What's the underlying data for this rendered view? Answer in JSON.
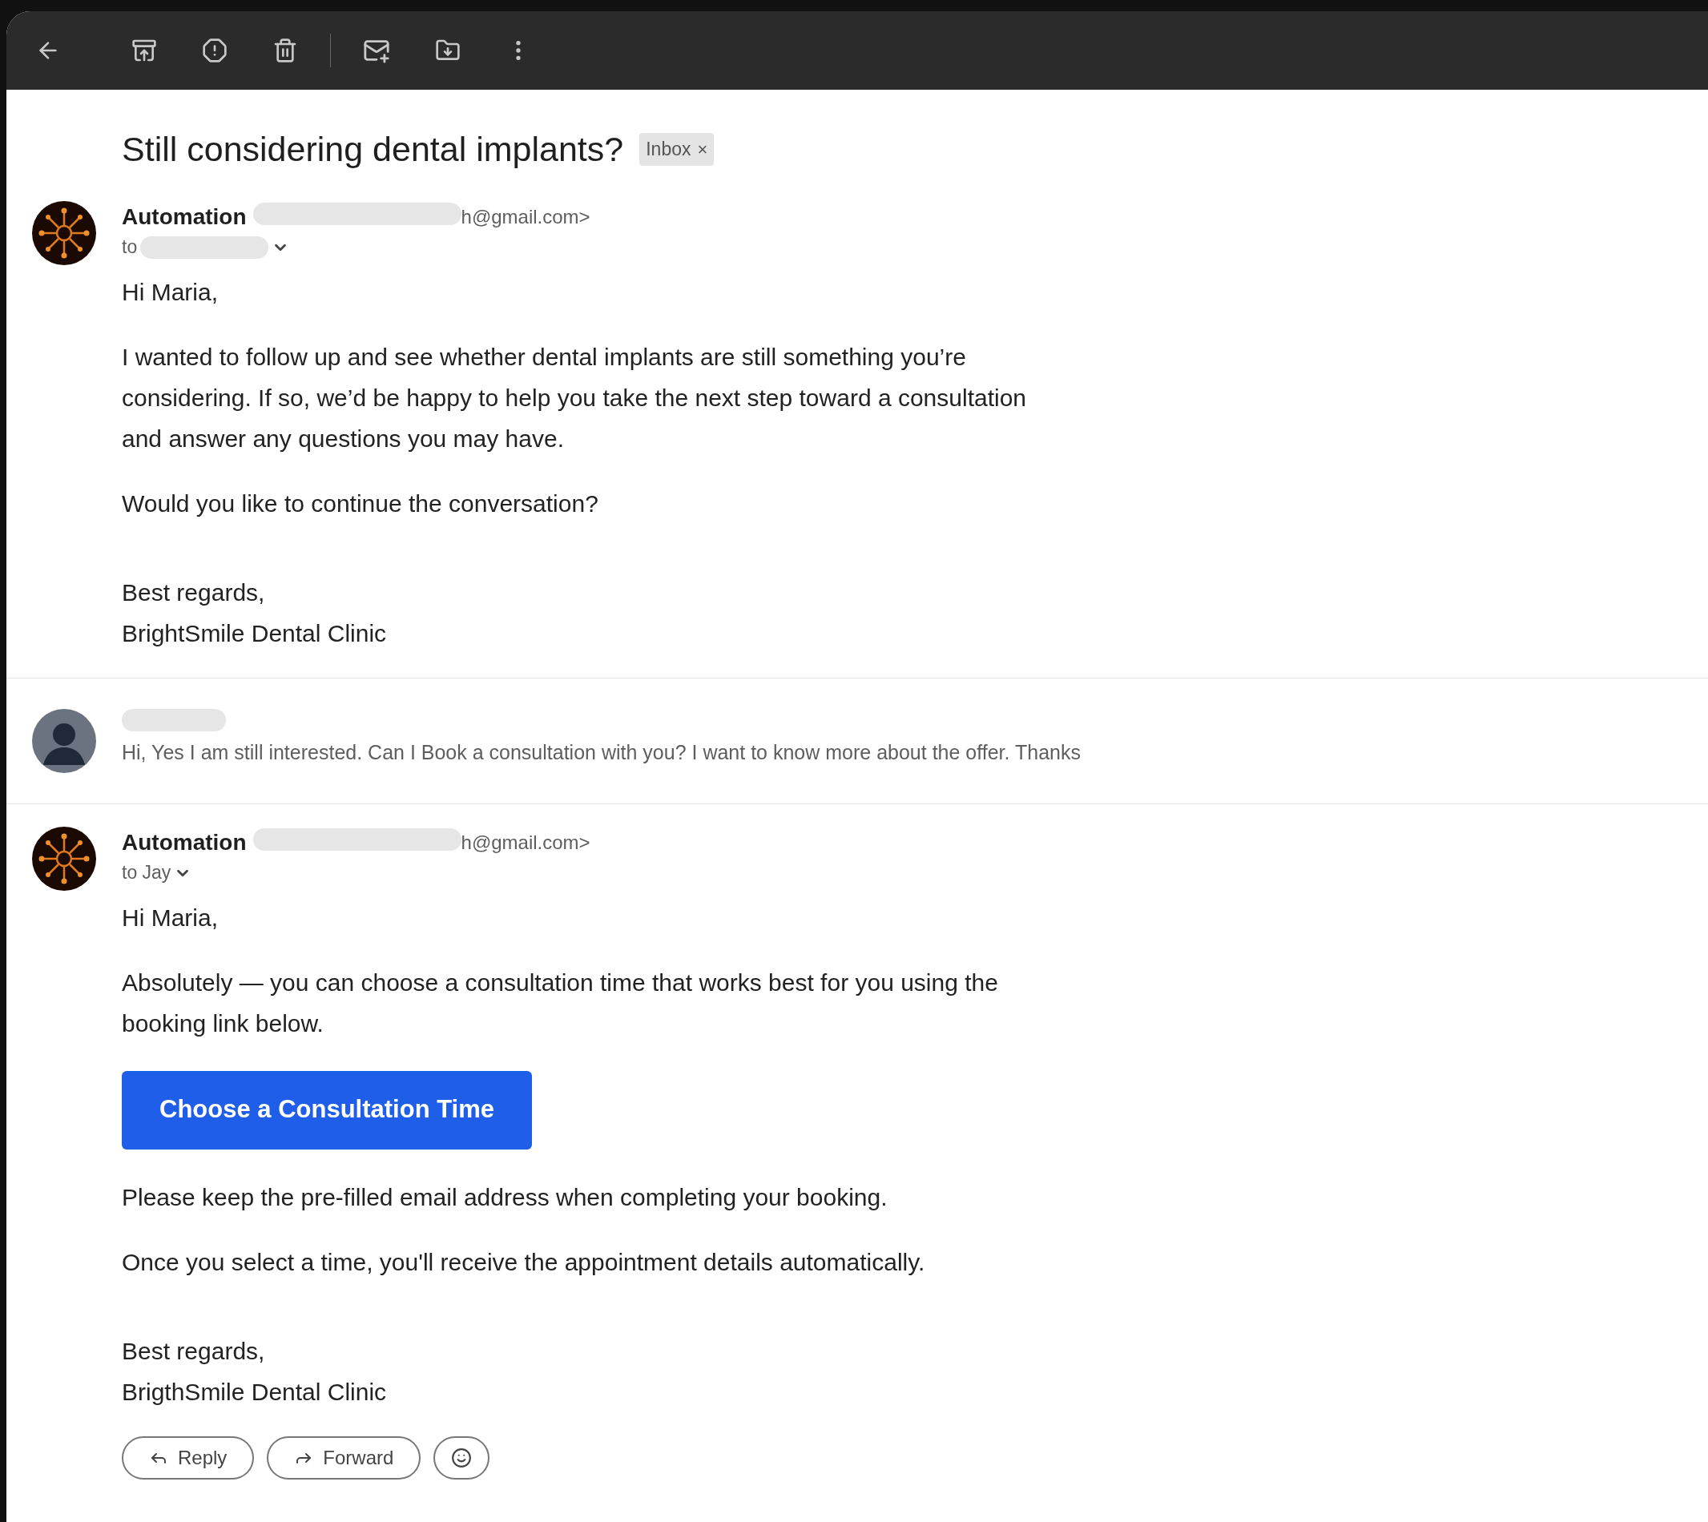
{
  "subject": "Still considering dental implants?",
  "label": {
    "text": "Inbox",
    "remove": "×"
  },
  "messages": [
    {
      "kind": "expanded",
      "sender": "Automation",
      "sender_redacted": true,
      "email_tail": "h@gmail.com>",
      "to": "to",
      "to_redacted": true,
      "blocks": [
        {
          "kind": "text",
          "text": "Hi Maria,"
        },
        {
          "kind": "text",
          "text": "I wanted to follow up and see whether dental implants are still something you’re considering. If so, we’d be happy to help you take the next step toward a consultation and answer any questions you may have."
        },
        {
          "kind": "text",
          "text": "Would you like to continue the conversation?"
        },
        {
          "kind": "signature",
          "lines": [
            "Best regards,",
            "BrightSmile Dental Clinic"
          ]
        }
      ]
    },
    {
      "kind": "collapsed",
      "sender_redacted": true,
      "snippet": "Hi, Yes I am still interested. Can I Book a consultation with you? I want to know more about the offer. Thanks"
    },
    {
      "kind": "expanded",
      "sender": "Automation",
      "sender_redacted": true,
      "email_tail": "h@gmail.com>",
      "to": "to Jay",
      "to_redacted": false,
      "blocks": [
        {
          "kind": "text",
          "text": "Hi Maria,"
        },
        {
          "kind": "text",
          "text": "Absolutely — you can choose a consultation time that works best for you using the booking link below."
        },
        {
          "kind": "button",
          "text": "Choose a Consultation Time"
        },
        {
          "kind": "text",
          "text": "Please keep the pre-filled email address when completing your booking."
        },
        {
          "kind": "text",
          "text": "Once you select a time, you'll receive the appointment details automatically."
        },
        {
          "kind": "signature",
          "lines": [
            "Best regards,",
            "BrigthSmile Dental Clinic"
          ]
        }
      ]
    }
  ],
  "actions": [
    {
      "kind": "reply",
      "label": "Reply"
    },
    {
      "kind": "forward",
      "label": "Forward"
    },
    {
      "kind": "emoji"
    }
  ]
}
